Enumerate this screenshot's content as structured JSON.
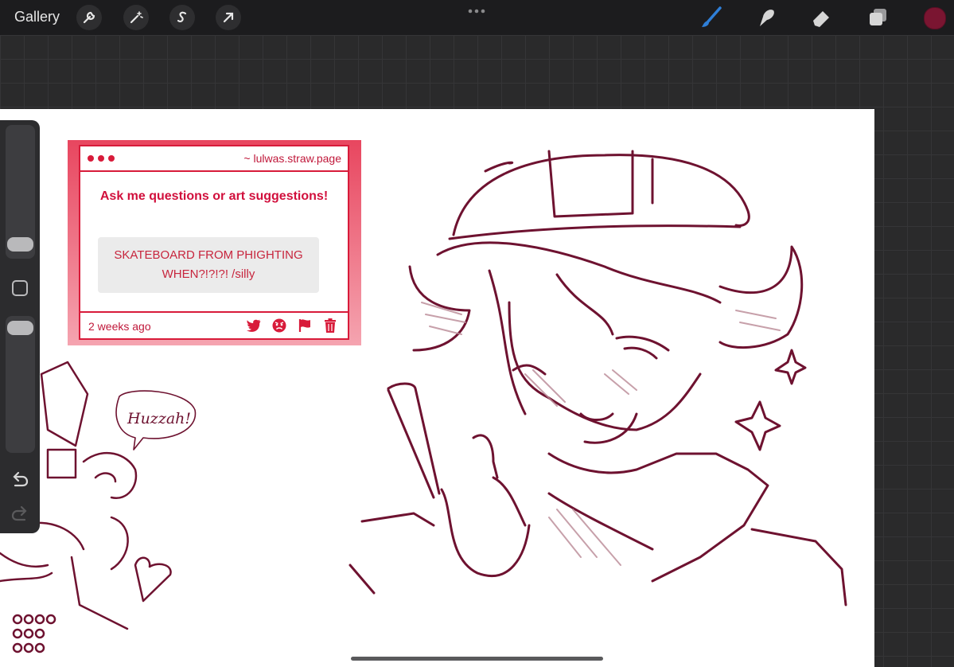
{
  "toolbar": {
    "gallery_label": "Gallery",
    "left_tools": [
      "wrench-icon",
      "magic-wand-icon",
      "selection-icon",
      "transform-arrow-icon"
    ],
    "right_tools": [
      "brush-icon",
      "smudge-icon",
      "eraser-icon",
      "layers-icon"
    ],
    "current_color": "#7a1531"
  },
  "card": {
    "url": "~ lulwas.straw.page",
    "prompt": "Ask me questions or art suggestions!",
    "message": "SKATEBOARD FROM PHIGHTING WHEN?!?!?! /silly",
    "timestamp": "2 weeks ago",
    "accent": "#d81b3a"
  },
  "drawing": {
    "speech_bubble": "Huzzah!",
    "line_color": "#6e1230"
  }
}
